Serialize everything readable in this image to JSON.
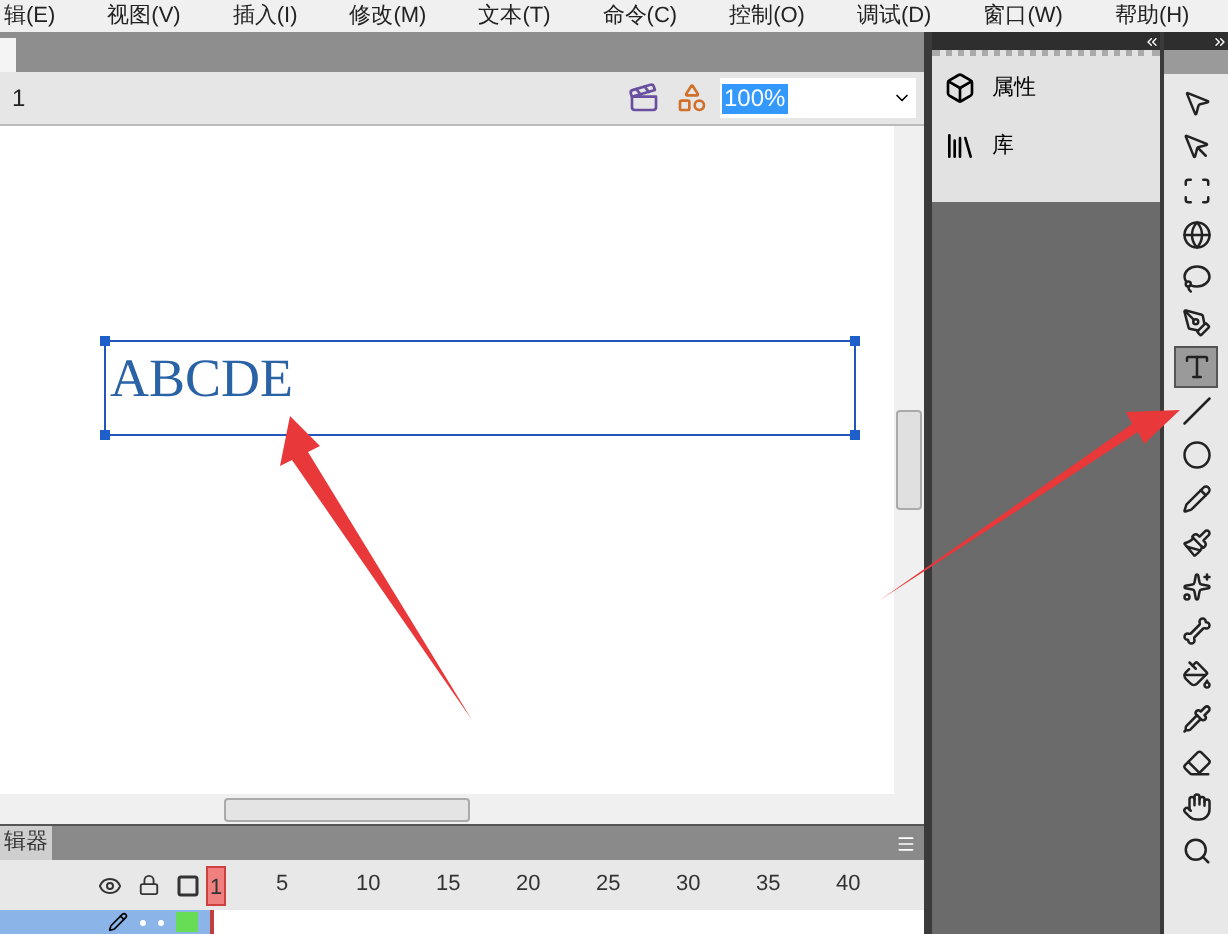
{
  "menu_bar": [
    "辑(E)",
    "视图(V)",
    "插入(I)",
    "修改(M)",
    "文本(T)",
    "命令(C)",
    "控制(O)",
    "调试(D)",
    "窗口(W)",
    "帮助(H)"
  ],
  "toolbar": {
    "breadcrumb": "1",
    "zoom": "100%"
  },
  "stage": {
    "text_field": "ABCDE"
  },
  "panels": [
    {
      "label": "属性"
    },
    {
      "label": "库"
    }
  ],
  "tools": [
    {
      "selected": false
    },
    {
      "selected": false
    },
    {
      "selected": false
    },
    {
      "selected": false
    },
    {
      "selected": false
    },
    {
      "selected": false
    },
    {
      "selected": true
    },
    {
      "selected": false
    },
    {
      "selected": false
    },
    {
      "selected": false
    },
    {
      "selected": false
    },
    {
      "selected": false
    },
    {
      "selected": false
    },
    {
      "selected": false
    },
    {
      "selected": false
    },
    {
      "selected": false
    },
    {
      "selected": false
    },
    {
      "selected": false
    }
  ],
  "timeline": {
    "title": "辑器",
    "frames": [
      {
        "label": "1",
        "selected": true
      },
      {
        "label": "5",
        "selected": false
      },
      {
        "label": "10",
        "selected": false
      },
      {
        "label": "15",
        "selected": false
      },
      {
        "label": "20",
        "selected": false
      },
      {
        "label": "25",
        "selected": false
      },
      {
        "label": "30",
        "selected": false
      },
      {
        "label": "35",
        "selected": false
      },
      {
        "label": "40",
        "selected": false
      }
    ],
    "layers": [
      {
        "selected": true,
        "color": "#66dd55"
      }
    ]
  }
}
